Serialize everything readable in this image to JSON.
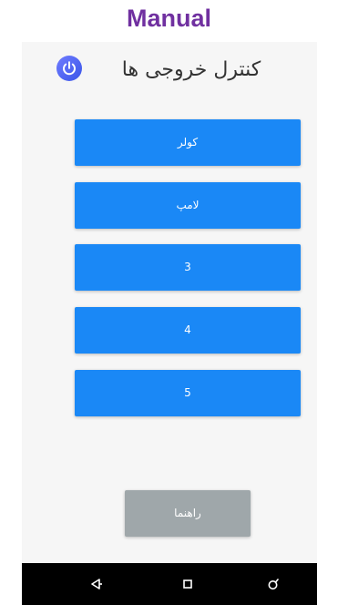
{
  "caption": "Manual",
  "header": {
    "title": "کنترل خروجی ها",
    "power_icon": "power-icon",
    "power_color": "#4a63f0"
  },
  "outputs": [
    {
      "label": "کولر"
    },
    {
      "label": "لامپ"
    },
    {
      "label": "3"
    },
    {
      "label": "4"
    },
    {
      "label": "5"
    }
  ],
  "help_button": {
    "label": "راهنما"
  },
  "colors": {
    "button_blue": "#1a88f6",
    "button_gray": "#9fa7aa",
    "caption": "#7030a0"
  },
  "navbar": {
    "back_icon": "back-triangle-icon",
    "home_icon": "home-square-icon",
    "recents_icon": "recents-icon"
  }
}
